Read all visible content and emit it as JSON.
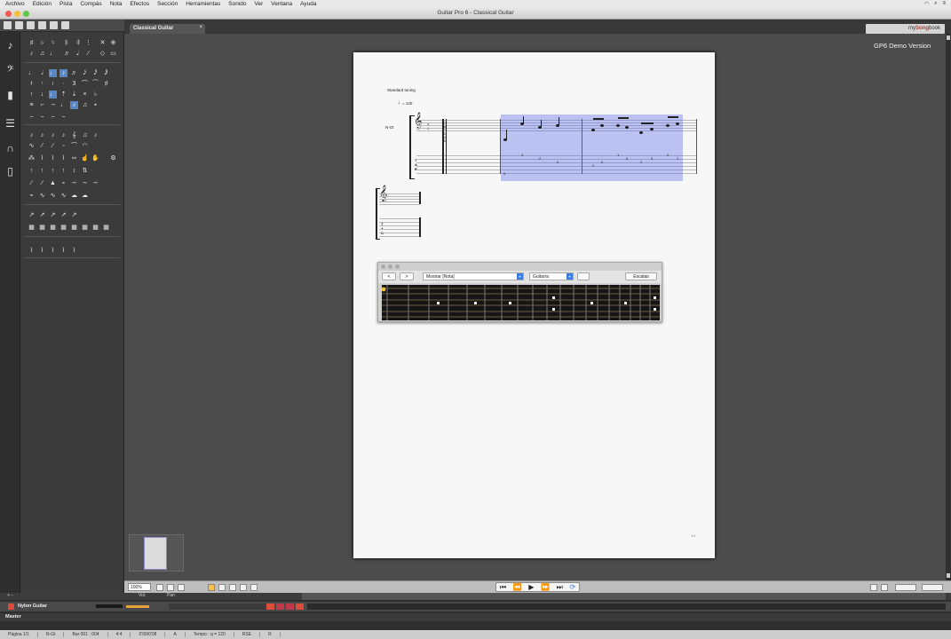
{
  "menu": [
    "Archivo",
    "Edición",
    "Pista",
    "Compás",
    "Nota",
    "Efectos",
    "Sección",
    "Herramientas",
    "Sonido",
    "Ver",
    "Ventana",
    "Ayuda"
  ],
  "window_title": "Guitar Pro 6 - Classical Guitar",
  "tab": {
    "label": "Classical Guitar"
  },
  "mysongbook": {
    "prefix": "my",
    "brand": "Song",
    "suffix": "book"
  },
  "demo_label": "GP6 Demo Version",
  "score": {
    "tuning": "Standard tuning",
    "tempo": "= 120",
    "track_abbrev": "N-Gt",
    "page_number": "1/1"
  },
  "fretboard": {
    "prev_label": "<",
    "next_label": ">",
    "show_label": "Mostrar [Nota]",
    "instrument": "Guitarra",
    "scales_label": "Escalas"
  },
  "transport": {
    "zoom": "100%"
  },
  "tracks": {
    "header_vol": "Vol.",
    "header_pan": "Pan",
    "track_name": "Nylon Guitar",
    "master_label": "Master"
  },
  "status": {
    "page": "Página 1/1",
    "track": "N-Gt",
    "bar": "Bar 001 : 004",
    "signature": "4:4",
    "time": "0'00/0'08",
    "key": "A",
    "tempo": "Tempo : q = 120",
    "rse": "RSE",
    "extra": "R"
  },
  "colors": {
    "selection": "#5a69e6",
    "accent": "#3d7fe0",
    "track_icon": "#d94d3a"
  }
}
